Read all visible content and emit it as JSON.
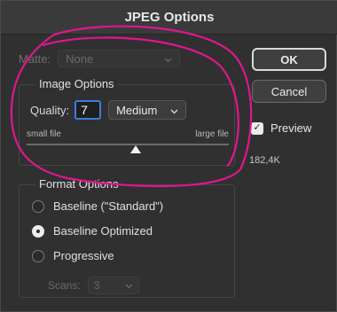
{
  "dialog": {
    "title": "JPEG Options"
  },
  "matte": {
    "label": "Matte:",
    "value": "None"
  },
  "image_options": {
    "legend": "Image Options",
    "quality_label": "Quality:",
    "quality_value": "7",
    "quality_preset": "Medium",
    "scale_small": "small file",
    "scale_large": "large file",
    "slider_fraction": 0.54
  },
  "format_options": {
    "legend": "Format Options",
    "baseline_standard": "Baseline (\"Standard\")",
    "baseline_optimized": "Baseline Optimized",
    "progressive": "Progressive",
    "scans_label": "Scans:",
    "scans_value": "3",
    "selected": "baseline_optimized"
  },
  "buttons": {
    "ok": "OK",
    "cancel": "Cancel"
  },
  "preview": {
    "label": "Preview",
    "checked": true,
    "file_size": "182,4K"
  },
  "icons": {
    "dropdown": "chevron-down-icon",
    "checkmark": "checkmark-icon",
    "slider": "slider-thumb-icon"
  },
  "colors": {
    "annotation": "#e0168f",
    "focus": "#3b7ee0",
    "background": "#303030"
  }
}
